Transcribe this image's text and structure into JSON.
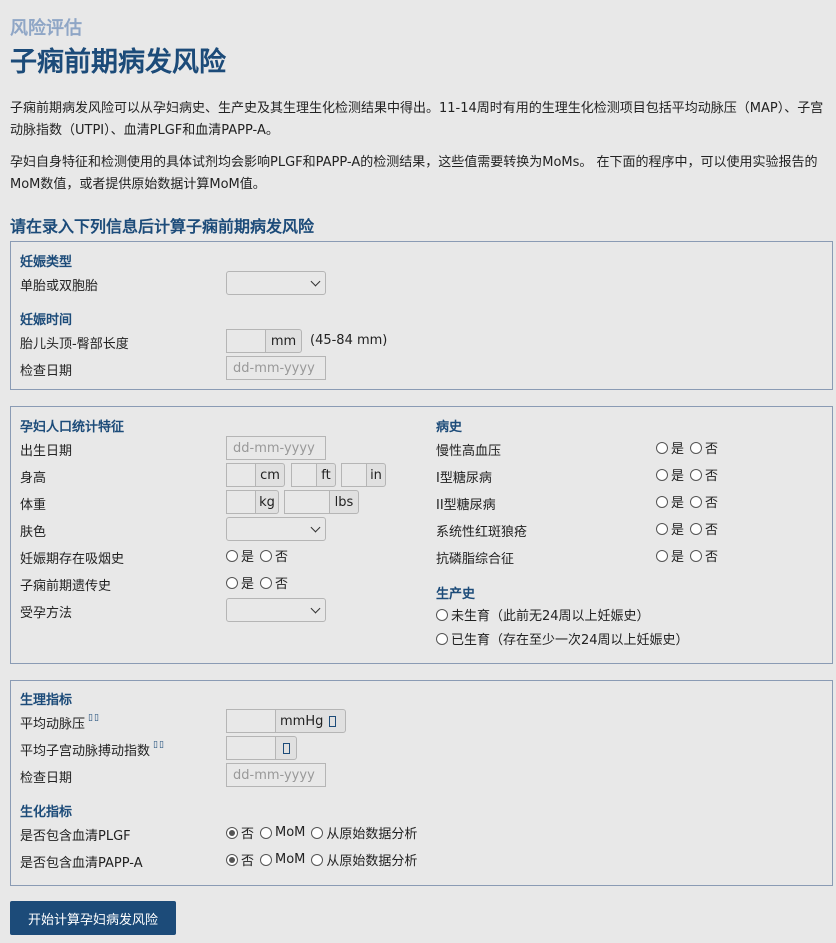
{
  "header": {
    "eyebrow": "风险评估",
    "title": "子痫前期病发风险"
  },
  "intro": {
    "p1": "子痫前期病发风险可以从孕妇病史、生产史及其生理生化检测结果中得出。11-14周时有用的生理生化检测项目包括平均动脉压（MAP）、子宫动脉指数（UTPI）、血清PLGF和血清PAPP-A。",
    "p2": "孕妇自身特征和检测使用的具体试剂均会影响PLGF和PAPP-A的检测结果，这些值需要转换为MoMs。 在下面的程序中，可以使用实验报告的MoM数值，或者提供原始数据计算MoM值。"
  },
  "form_heading": "请在录入下列信息后计算子痫前期病发风险",
  "pregnancy": {
    "type_title": "妊娠类型",
    "type_label": "单胎或双胞胎",
    "time_title": "妊娠时间",
    "crl_label": "胎儿头顶-臀部长度",
    "crl_unit": "mm",
    "crl_range": "(45-84 mm)",
    "exam_date_label": "检查日期",
    "date_placeholder": "dd-mm-yyyy"
  },
  "demographics": {
    "title": "孕妇人口统计特征",
    "dob_label": "出生日期",
    "height_label": "身高",
    "height_units": [
      "cm",
      "ft",
      "in"
    ],
    "weight_label": "体重",
    "weight_units": [
      "kg",
      "lbs"
    ],
    "skin_label": "肤色",
    "smoking_label": "妊娠期存在吸烟史",
    "family_label": "子痫前期遗传史",
    "conception_label": "受孕方法",
    "yes": "是",
    "no": "否"
  },
  "history": {
    "title": "病史",
    "items": [
      "慢性高血压",
      "I型糖尿病",
      "II型糖尿病",
      "系统性红斑狼疮",
      "抗磷脂综合征"
    ],
    "yes": "是",
    "no": "否"
  },
  "obstetric": {
    "title": "生产史",
    "option1": "未生育（此前无24周以上妊娠史）",
    "option2": "已生育（存在至少一次24周以上妊娠史）"
  },
  "biophysical": {
    "title": "生理指标",
    "map_label": "平均动脉压",
    "map_unit": "mmHg",
    "utpi_label": "平均子宫动脉搏动指数",
    "exam_date_label": "检查日期",
    "date_placeholder": "dd-mm-yyyy"
  },
  "biochemical": {
    "title": "生化指标",
    "plgf_label": "是否包含血清PLGF",
    "pappa_label": "是否包含血清PAPP-A",
    "opt_no": "否",
    "opt_mom": "MoM",
    "opt_raw": "从原始数据分析"
  },
  "submit_label": "开始计算孕妇病发风险",
  "colors": {
    "accent": "#1c4b79",
    "eyebrow": "#8fa6c6",
    "background": "#e8e8e8",
    "panel_border": "#8a9bb4"
  }
}
